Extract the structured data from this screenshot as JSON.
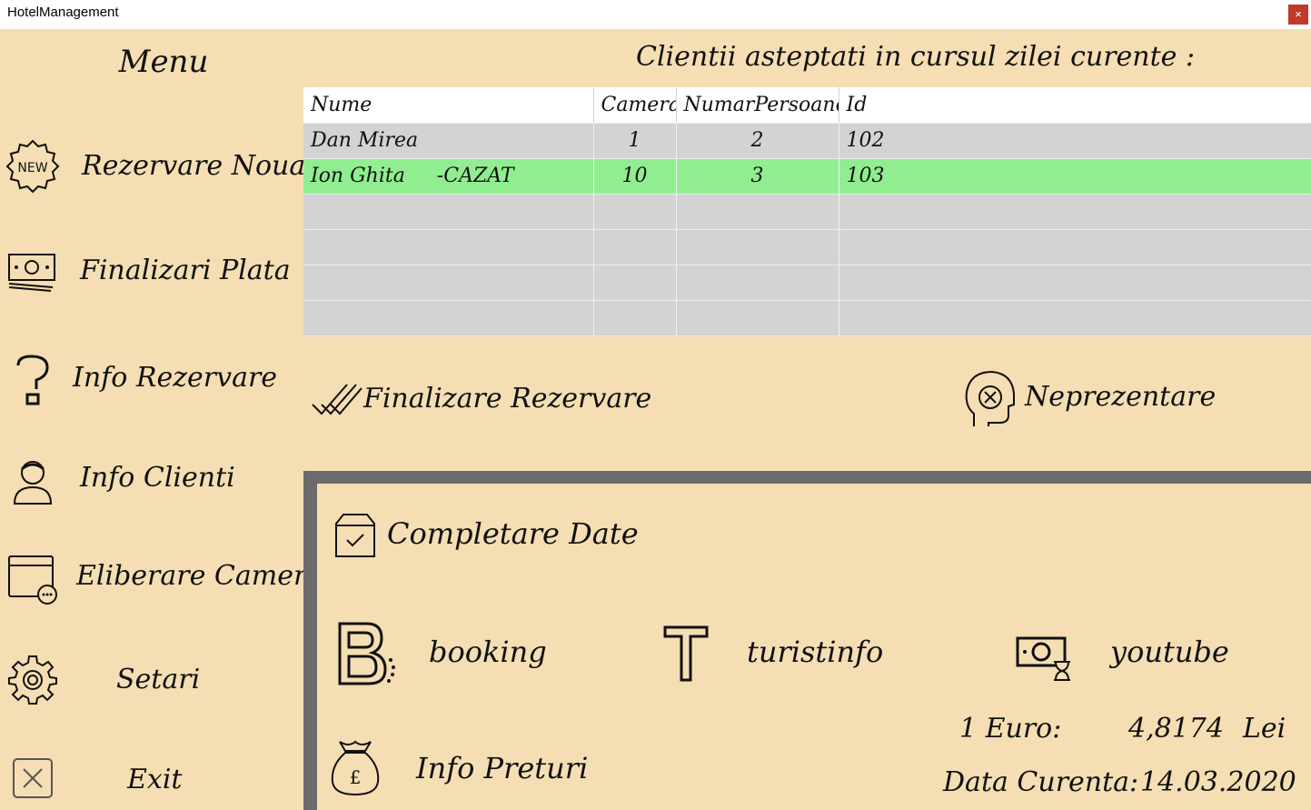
{
  "window": {
    "title": "HotelManagement",
    "close_glyph": "×"
  },
  "sidebar": {
    "title": "Menu",
    "items": [
      {
        "label": "Rezervare Noua",
        "icon": "new-badge-icon"
      },
      {
        "label": "Finalizari Plata",
        "icon": "money-stack-icon"
      },
      {
        "label": "Info Rezervare",
        "icon": "question-mark-icon"
      },
      {
        "label": "Info Clienti",
        "icon": "user-icon"
      },
      {
        "label": "Eliberare Camere",
        "icon": "window-options-icon"
      },
      {
        "label": "Setari",
        "icon": "gear-icon"
      },
      {
        "label": "Exit",
        "icon": "close-box-icon"
      }
    ]
  },
  "main": {
    "heading": "Clientii asteptati in cursul zilei curente :",
    "table": {
      "columns": [
        "Nume",
        "Camera",
        "NumarPersoane",
        "Id"
      ],
      "rows": [
        {
          "nume": "Dan Mirea",
          "camera": "1",
          "persoane": "2",
          "id": "102"
        },
        {
          "nume": "Ion Ghita     -CAZAT",
          "camera": "10",
          "persoane": "3",
          "id": "103"
        }
      ]
    },
    "actions": {
      "finalize_label": "Finalizare Rezervare",
      "noshow_label": "Neprezentare"
    }
  },
  "panel": {
    "completare_label": "Completare Date",
    "links": {
      "booking": "booking",
      "turistinfo": "turistinfo",
      "youtube": "youtube"
    },
    "info_preturi_label": "Info Preturi",
    "exchange": {
      "prefix": "1 Euro:",
      "value": "4,8174",
      "unit": "Lei"
    },
    "date": {
      "label": "Data Curenta:",
      "value": "14.03.2020"
    }
  },
  "colors": {
    "background": "#f5deb3",
    "row_selected": "#90ee90",
    "row_default": "#d3d3d3",
    "panel_border": "#6b6b6b",
    "close": "#c0392b"
  }
}
